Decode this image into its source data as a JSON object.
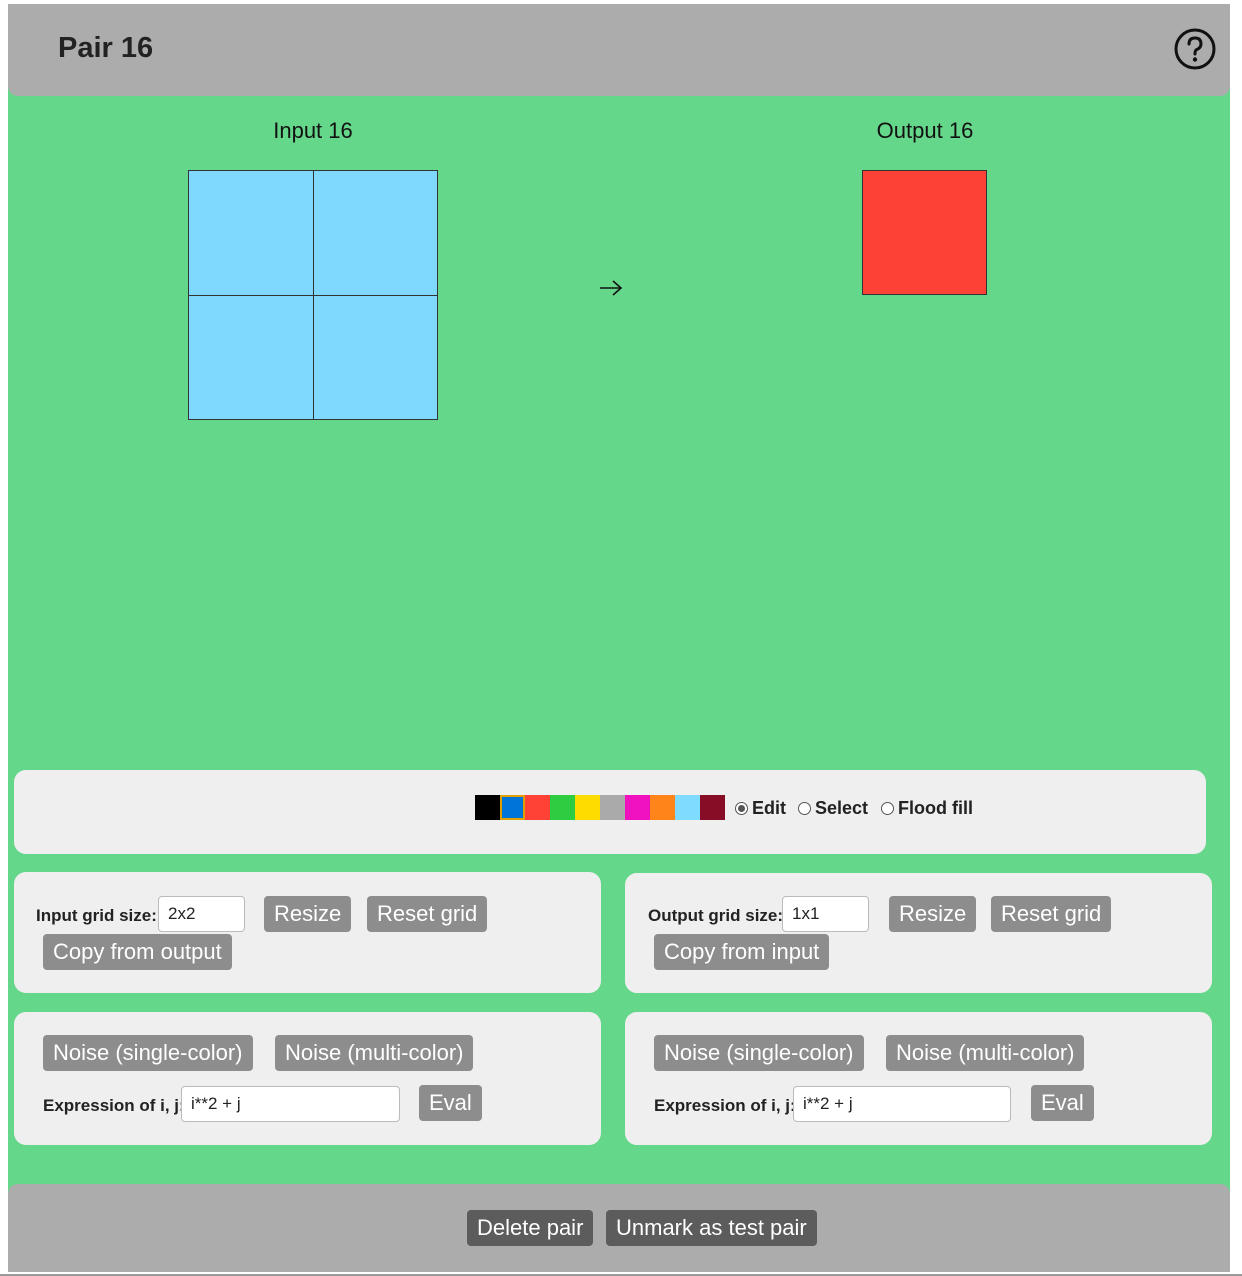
{
  "header": {
    "title": "Pair 16",
    "help_icon": "question-circle-icon"
  },
  "input_grid": {
    "title": "Input 16",
    "size": [
      2,
      2
    ],
    "cells": [
      [
        "#7fd8fd",
        "#7fd8fd"
      ],
      [
        "#7fd8fd",
        "#7fd8fd"
      ]
    ]
  },
  "arrow": {
    "icon": "right-arrow-icon"
  },
  "output_grid": {
    "title": "Output 16",
    "size": [
      1,
      1
    ],
    "cells": [
      [
        "#fe4136"
      ]
    ]
  },
  "toolbar": {
    "palette": [
      "#000000",
      "#0074d9",
      "#ff4136",
      "#2ecc40",
      "#ffdc00",
      "#aaaaaa",
      "#f012be",
      "#ff851b",
      "#7fdbff",
      "#870c25"
    ],
    "selected_color_index": 1,
    "modes": [
      {
        "label": "Edit",
        "checked": true
      },
      {
        "label": "Select",
        "checked": false
      },
      {
        "label": "Flood fill",
        "checked": false
      }
    ]
  },
  "input_controls": {
    "size_label": "Input grid size:",
    "size_value": "2x2",
    "resize": "Resize",
    "reset": "Reset grid",
    "copy": "Copy from output",
    "noise_single": "Noise (single-color)",
    "noise_multi": "Noise (multi-color)",
    "expr_label": "Expression of i, j:",
    "expr_value": "i**2 + j",
    "eval": "Eval"
  },
  "output_controls": {
    "size_label": "Output grid size:",
    "size_value": "1x1",
    "resize": "Resize",
    "reset": "Reset grid",
    "copy": "Copy from input",
    "noise_single": "Noise (single-color)",
    "noise_multi": "Noise (multi-color)",
    "expr_label": "Expression of i, j:",
    "expr_value": "i**2 + j",
    "eval": "Eval"
  },
  "footer": {
    "delete": "Delete pair",
    "unmark": "Unmark as test pair"
  }
}
